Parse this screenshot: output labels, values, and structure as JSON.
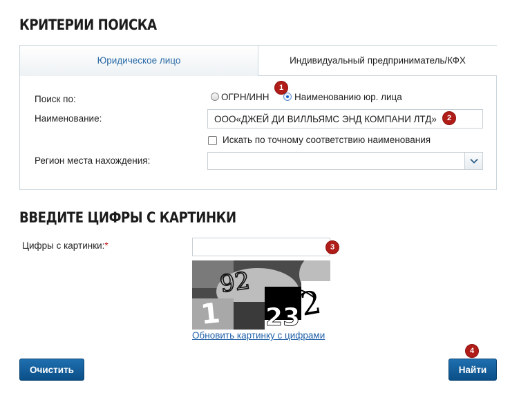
{
  "search_criteria": {
    "title": "КРИТЕРИИ ПОИСКА",
    "tabs": [
      {
        "label": "Юридическое лицо",
        "active": true
      },
      {
        "label": "Индивидуальный предприниматель/КФХ",
        "active": false
      }
    ],
    "search_by_label": "Поиск по:",
    "search_by_options": [
      {
        "label": "ОГРН/ИНН",
        "checked": false
      },
      {
        "label": "Наименованию юр. лица",
        "checked": true
      }
    ],
    "name_label": "Наименование:",
    "name_value": "ООО«ДЖЕЙ ДИ ВИЛЛЬЯМС ЭНД КОМПАНИ ЛТД»",
    "exact_match_label": "Искать по точному соответствию наименования",
    "exact_match_checked": false,
    "region_label": "Регион места нахождения:",
    "region_value": ""
  },
  "captcha": {
    "title": "ВВЕДИТЕ ЦИФРЫ С КАРТИНКИ",
    "field_label": "Цифры с картинки:",
    "required_mark": "*",
    "field_value": "",
    "captcha_digits": "921232",
    "refresh_link": "Обновить картинку с цифрами"
  },
  "buttons": {
    "clear": "Очистить",
    "search": "Найти"
  },
  "badges": [
    "1",
    "2",
    "3",
    "4"
  ],
  "colors": {
    "tab_active_text": "#2a6aa6",
    "button_bg": "#0b4f87",
    "badge_bg": "#b01c17",
    "link": "#1f5fa8",
    "radio_checked": "#1a63c8"
  }
}
